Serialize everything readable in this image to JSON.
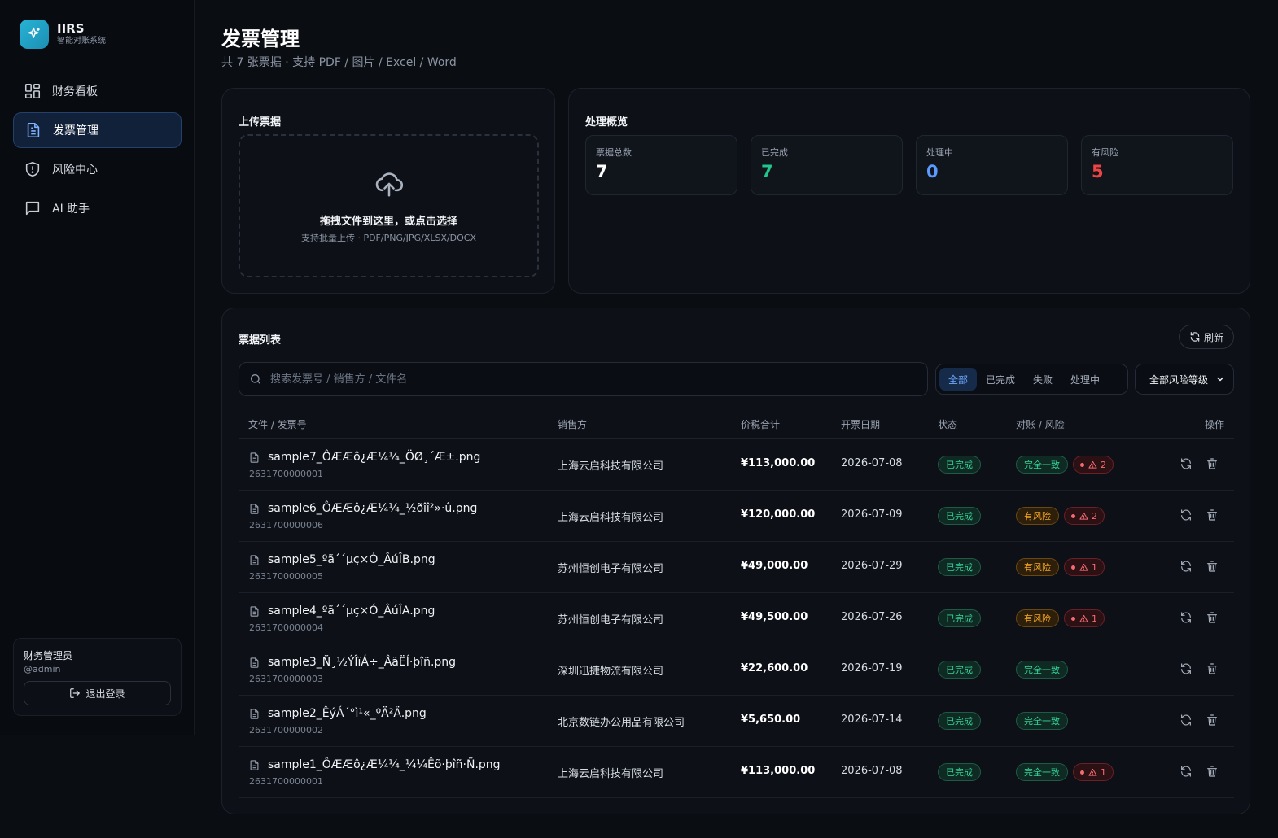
{
  "brand": {
    "name": "IIRS",
    "subtitle": "智能对账系统"
  },
  "nav": [
    {
      "label": "财务看板",
      "icon": "dashboard-icon"
    },
    {
      "label": "发票管理",
      "icon": "document-icon",
      "active": true
    },
    {
      "label": "风险中心",
      "icon": "shield-icon"
    },
    {
      "label": "AI 助手",
      "icon": "chat-icon"
    }
  ],
  "user": {
    "name": "财务管理员",
    "handle": "@admin",
    "logout_label": "退出登录"
  },
  "page": {
    "title": "发票管理",
    "subtitle": "共 7 张票据 · 支持 PDF / 图片 / Excel / Word"
  },
  "upload": {
    "title": "上传票据",
    "main_text": "拖拽文件到这里，或点击选择",
    "hint": "支持批量上传 · PDF/PNG/JPG/XLSX/DOCX"
  },
  "overview": {
    "title": "处理概览",
    "stats": [
      {
        "label": "票据总数",
        "value": "7",
        "color": "#ffffff"
      },
      {
        "label": "已完成",
        "value": "7",
        "color": "#22c58b"
      },
      {
        "label": "处理中",
        "value": "0",
        "color": "#5b9bff"
      },
      {
        "label": "有风险",
        "value": "5",
        "color": "#ef4444"
      }
    ]
  },
  "list": {
    "title": "票据列表",
    "refresh_label": "刷新",
    "search_placeholder": "搜索发票号 / 销售方 / 文件名",
    "filters": [
      "全部",
      "已完成",
      "失败",
      "处理中"
    ],
    "risk_filter": "全部风险等级",
    "columns": {
      "file": "文件 / 发票号",
      "seller": "销售方",
      "amount": "价税合计",
      "date": "开票日期",
      "status": "状态",
      "recon": "对账 / 风险",
      "actions": "操作"
    },
    "rows": [
      {
        "file": "sample7_ÔÆÆô¿Æ¼¼_ÖØ¸´Æ±.png",
        "invoice_no": "2631700000001",
        "seller": "上海云启科技有限公司",
        "amount": "¥113,000.00",
        "date": "2026-07-08",
        "status": "已完成",
        "recon": "完全一致",
        "recon_type": "green",
        "risk_count": "2"
      },
      {
        "file": "sample6_ÔÆÆô¿Æ¼¼_½ðîî²»·û.png",
        "invoice_no": "2631700000006",
        "seller": "上海云启科技有限公司",
        "amount": "¥120,000.00",
        "date": "2026-07-09",
        "status": "已完成",
        "recon": "有风险",
        "recon_type": "orange",
        "risk_count": "2"
      },
      {
        "file": "sample5_ºã´´µç×Ó_ÂúÎB.png",
        "invoice_no": "2631700000005",
        "seller": "苏州恒创电子有限公司",
        "amount": "¥49,000.00",
        "date": "2026-07-29",
        "status": "已完成",
        "recon": "有风险",
        "recon_type": "orange",
        "risk_count": "1"
      },
      {
        "file": "sample4_ºã´´µç×Ó_ÂúÎA.png",
        "invoice_no": "2631700000004",
        "seller": "苏州恒创电子有限公司",
        "amount": "¥49,500.00",
        "date": "2026-07-26",
        "status": "已完成",
        "recon": "有风险",
        "recon_type": "orange",
        "risk_count": "1"
      },
      {
        "file": "sample3_Ñ¸½ÝÎïÁ÷_ÂãËÍ·þîñ.png",
        "invoice_no": "2631700000003",
        "seller": "深圳迅捷物流有限公司",
        "amount": "¥22,600.00",
        "date": "2026-07-19",
        "status": "已完成",
        "recon": "完全一致",
        "recon_type": "green",
        "risk_count": ""
      },
      {
        "file": "sample2_ÊýÁ´°ì¹«_ºÄ²Ä.png",
        "invoice_no": "2631700000002",
        "seller": "北京数链办公用品有限公司",
        "amount": "¥5,650.00",
        "date": "2026-07-14",
        "status": "已完成",
        "recon": "完全一致",
        "recon_type": "green",
        "risk_count": ""
      },
      {
        "file": "sample1_ÔÆÆô¿Æ¼¼_¼¼Êõ·þîñ·Ñ.png",
        "invoice_no": "2631700000001",
        "seller": "上海云启科技有限公司",
        "amount": "¥113,000.00",
        "date": "2026-07-08",
        "status": "已完成",
        "recon": "完全一致",
        "recon_type": "green",
        "risk_count": "1"
      }
    ]
  }
}
